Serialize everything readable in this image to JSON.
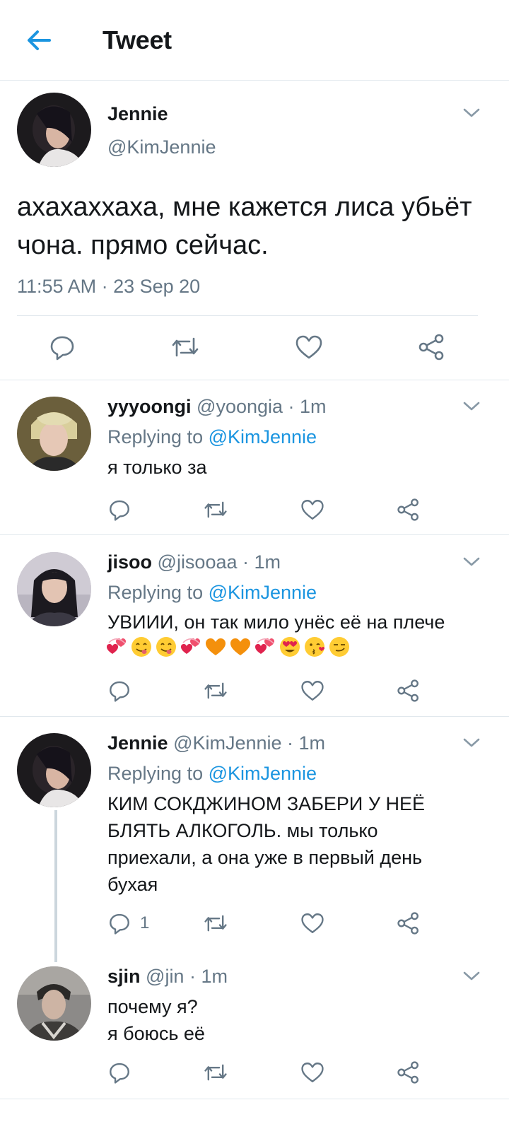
{
  "header": {
    "title": "Tweet",
    "back_icon": "arrow-left-icon"
  },
  "main_tweet": {
    "name": "Jennie",
    "handle": "@KimJennie",
    "text": "ахахаххаха, мне кажется лиса убьёт чона. прямо сейчас.",
    "timestamp": "11:55 AM · 23 Sep 20"
  },
  "replies": [
    {
      "name": "yyyoongi",
      "meta": "@yoongia · 1m",
      "replying_prefix": "Replying to ",
      "replying_handle": "@KimJennie",
      "text": "я только за",
      "reply_count": ""
    },
    {
      "name": "jisoo",
      "meta": "@jisooaa · 1m",
      "replying_prefix": "Replying to ",
      "replying_handle": "@KimJennie",
      "text": "УВИИИ, он так мило унёс её на плече",
      "emoji": [
        "revolving-hearts",
        "yum-face",
        "yum-face",
        "revolving-hearts",
        "orange-heart",
        "orange-heart",
        "revolving-hearts",
        "heart-eyes-face",
        "kissing-face",
        "smirk-face"
      ],
      "reply_count": ""
    },
    {
      "name": "Jennie",
      "meta": "@KimJennie · 1m",
      "replying_prefix": "Replying to ",
      "replying_handle": "@KimJennie",
      "text": "КИМ СОКДЖИНОМ ЗАБЕРИ У НЕЁ\nБЛЯТЬ АЛКОГОЛЬ. мы только\nприехали, а она уже в первый день\nбухая",
      "reply_count": "1"
    },
    {
      "name": "sjin",
      "meta": "@jin · 1m",
      "text": "почему я?\nя боюсь её",
      "reply_count": ""
    }
  ],
  "colors": {
    "accent": "#1b95e0",
    "muted": "#657786",
    "divider": "#e1e8ed"
  }
}
